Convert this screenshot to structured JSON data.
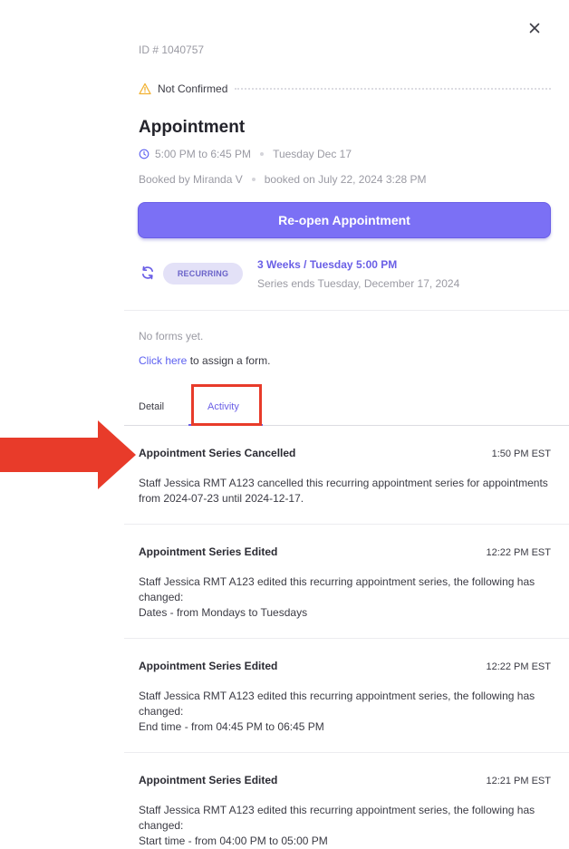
{
  "appointment": {
    "id_label": "ID # 1040757",
    "status": "Not Confirmed",
    "title": "Appointment",
    "time_range": "5:00 PM to 6:45 PM",
    "date": "Tuesday Dec 17",
    "booked_by": "Booked by Miranda V",
    "booked_on": "booked on July 22, 2024 3:28 PM",
    "reopen_label": "Re-open Appointment"
  },
  "recurring": {
    "badge": "RECURRING",
    "schedule": "3 Weeks / Tuesday 5:00 PM",
    "ends": "Series ends Tuesday, December 17, 2024"
  },
  "forms": {
    "empty_text": "No forms yet.",
    "link_text": "Click here",
    "suffix_text": " to assign a form."
  },
  "tabs": [
    {
      "label": "Detail"
    },
    {
      "label": "Activity"
    }
  ],
  "activity": [
    {
      "title": "Appointment Series Cancelled",
      "time": "1:50 PM EST",
      "lines": [
        "Staff Jessica RMT A123 cancelled this recurring appointment series for appointments from 2024-07-23 until 2024-12-17."
      ]
    },
    {
      "title": "Appointment Series Edited",
      "time": "12:22 PM EST",
      "lines": [
        "Staff Jessica RMT A123 edited this recurring appointment series, the following has changed:",
        "Dates - from Mondays to Tuesdays"
      ]
    },
    {
      "title": "Appointment Series Edited",
      "time": "12:22 PM EST",
      "lines": [
        "Staff Jessica RMT A123 edited this recurring appointment series, the following has changed:",
        "End time - from 04:45 PM to 06:45 PM"
      ]
    },
    {
      "title": "Appointment Series Edited",
      "time": "12:21 PM EST",
      "lines": [
        "Staff Jessica RMT A123 edited this recurring appointment series, the following has changed:",
        "Start time - from 04:00 PM to 05:00 PM"
      ]
    }
  ],
  "colors": {
    "accent": "#7b70f5",
    "annotation_red": "#e83b2a",
    "warning": "#f2b233"
  },
  "icons": {
    "close": "close-icon",
    "status": "warning-icon",
    "time": "clock-icon",
    "recurring": "refresh-icon"
  }
}
